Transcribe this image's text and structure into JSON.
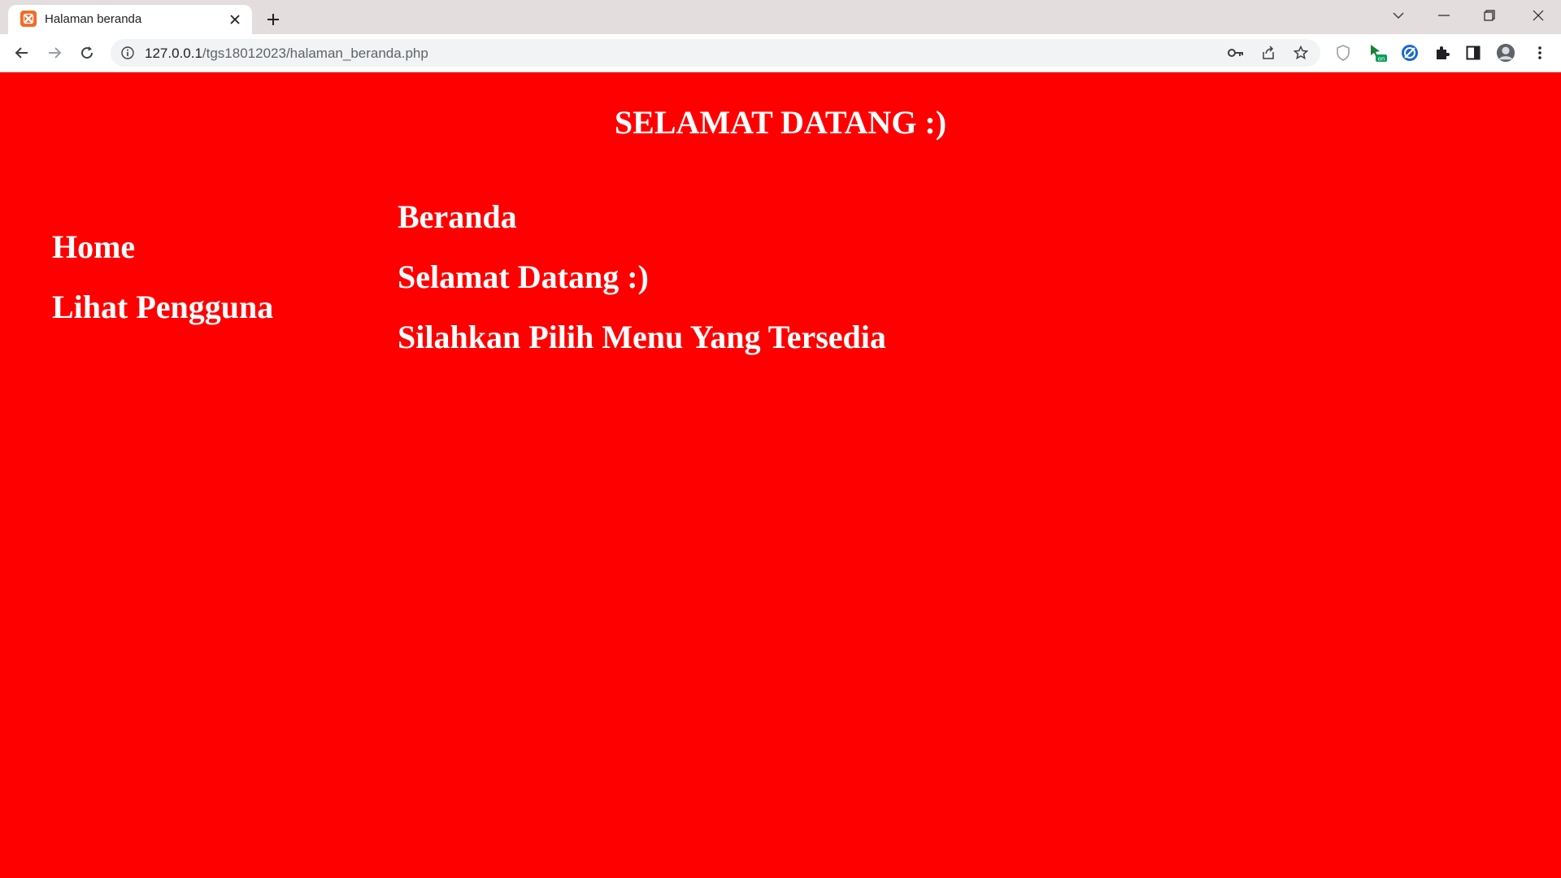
{
  "browser": {
    "tab_title": "Halaman beranda",
    "url_host": "127.0.0.1",
    "url_path": "/tgs18012023/halaman_beranda.php"
  },
  "page": {
    "title": "SELAMAT DATANG :)",
    "sidebar": {
      "items": [
        {
          "label": "Home"
        },
        {
          "label": "Lihat Pengguna"
        }
      ]
    },
    "content": {
      "heading": "Beranda",
      "greeting": "Selamat Datang :)",
      "instruction": "Silahkan Pilih Menu Yang Tersedia"
    }
  },
  "colors": {
    "page_background": "#ff0000",
    "text": "#ffffff",
    "favicon": "#f26b2a"
  }
}
